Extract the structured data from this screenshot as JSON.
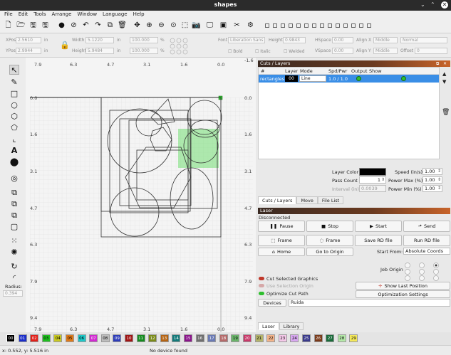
{
  "window": {
    "title": "shapes"
  },
  "menu": [
    "File",
    "Edit",
    "Tools",
    "Arrange",
    "Window",
    "Language",
    "Help"
  ],
  "toolbar_icons": [
    "new-file",
    "open-folder",
    "save",
    "save-as",
    "circle-fill",
    "stop-circle",
    "undo",
    "redo",
    "copy",
    "paste",
    "delete",
    "move",
    "zoom-in",
    "zoom-out",
    "zoom-fit",
    "zoom-page",
    "camera",
    "monitor",
    "frame",
    "tools",
    "settings"
  ],
  "props": {
    "xpos_label": "XPos",
    "xpos": "2.5610",
    "ypos_label": "YPos",
    "ypos": "2.9944",
    "width_label": "Width",
    "width": "5.1220",
    "height_label": "Height",
    "height": "5.9484",
    "unit": "in",
    "pct1": "100.000",
    "pct2": "100.000",
    "pct_unit": "%",
    "font_label": "Font",
    "font": "Liberation Sans",
    "fheight_label": "Height",
    "fheight": "0.9843",
    "hspace_label": "HSpace",
    "hspace": "0.00",
    "vspace_label": "VSpace",
    "vspace": "0.00",
    "alignx_label": "Align X",
    "alignx": "Middle",
    "aligny_label": "Align Y",
    "aligny": "Middle",
    "normal": "Normal",
    "offset_label": "Offset",
    "offset": "0",
    "bold": "Bold",
    "italic": "Italic",
    "welded": "Welded"
  },
  "tools": {
    "radius_label": "Radius:",
    "radius": "0.394"
  },
  "ruler": {
    "top": [
      "7.9",
      "6.3",
      "4.7",
      "3.1",
      "1.6",
      "0.0"
    ],
    "top_extra": "-1.6",
    "left": [
      "0.0",
      "1.6",
      "3.1",
      "4.7",
      "6.3",
      "7.9",
      "9.4"
    ],
    "right": [
      "0.0",
      "1.6",
      "3.1",
      "4.7",
      "6.3",
      "7.9",
      "9.4"
    ],
    "bottom": [
      "7.9",
      "6.3",
      "4.7",
      "3.1",
      "1.6",
      "0.0"
    ]
  },
  "cuts": {
    "title": "Cuts / Layers",
    "columns": [
      "#",
      "Layer",
      "Mode",
      "Spd/Pwr",
      "Output",
      "Show"
    ],
    "row": {
      "name": "rectangles",
      "layer": "00",
      "mode": "Line",
      "spdpwr": "1.0 / 1.0"
    },
    "layer_color_label": "Layer Color",
    "layer_color": "#000000",
    "speed_label": "Speed (in/s)",
    "speed": "1.00",
    "pass_label": "Pass Count",
    "pass": "1",
    "pmax_label": "Power Max (%)",
    "pmax": "1.00",
    "interval_label": "Interval (in)",
    "interval": "0.0039",
    "pmin_label": "Power Min (%)",
    "pmin": "1.00",
    "tabs": [
      "Cuts / Layers",
      "Move",
      "File List"
    ]
  },
  "laser": {
    "title": "Laser",
    "status": "Disconnected",
    "pause": "Pause",
    "stop": "Stop",
    "start": "Start",
    "send": "Send",
    "frame1": "Frame",
    "frame2": "Frame",
    "save_rd": "Save RD file",
    "run_rd": "Run RD file",
    "home": "Home",
    "goto_origin": "Go to Origin",
    "start_from_label": "Start From:",
    "start_from": "Absolute Coords",
    "job_origin": "Job Origin",
    "cut_selected": "Cut Selected Graphics",
    "use_selection": "Use Selection Origin",
    "optimize": "Optimize Cut Path",
    "show_last": "Show Last Position",
    "opt_settings": "Optimization Settings",
    "devices": "Devices",
    "device": "Ruida",
    "tabs": [
      "Laser",
      "Library"
    ]
  },
  "palette": [
    {
      "n": "00",
      "c": "#000000",
      "t": "#ffffff"
    },
    {
      "n": "01",
      "c": "#1b2ec8",
      "t": "#ffffff"
    },
    {
      "n": "02",
      "c": "#e0201a",
      "t": "#ffffff"
    },
    {
      "n": "03",
      "c": "#1fbf1f",
      "t": "#000000"
    },
    {
      "n": "04",
      "c": "#c8c824",
      "t": "#000000"
    },
    {
      "n": "05",
      "c": "#e07a18",
      "t": "#000000"
    },
    {
      "n": "06",
      "c": "#1ec8c8",
      "t": "#000000"
    },
    {
      "n": "07",
      "c": "#d02ad0",
      "t": "#ffffff"
    },
    {
      "n": "08",
      "c": "#bdbdbd",
      "t": "#000000"
    },
    {
      "n": "09",
      "c": "#2d3cb8",
      "t": "#ffffff"
    },
    {
      "n": "10",
      "c": "#a01414",
      "t": "#ffffff"
    },
    {
      "n": "11",
      "c": "#148a20",
      "t": "#ffffff"
    },
    {
      "n": "12",
      "c": "#7a8a1a",
      "t": "#ffffff"
    },
    {
      "n": "13",
      "c": "#b46414",
      "t": "#ffffff"
    },
    {
      "n": "14",
      "c": "#147a7a",
      "t": "#ffffff"
    },
    {
      "n": "15",
      "c": "#8a148a",
      "t": "#ffffff"
    },
    {
      "n": "16",
      "c": "#6e6e6e",
      "t": "#ffffff"
    },
    {
      "n": "17",
      "c": "#6a7ab4",
      "t": "#ffffff"
    },
    {
      "n": "18",
      "c": "#b46a6a",
      "t": "#ffffff"
    },
    {
      "n": "19",
      "c": "#6ab46a",
      "t": "#000000"
    },
    {
      "n": "20",
      "c": "#c83a6a",
      "t": "#ffffff"
    },
    {
      "n": "21",
      "c": "#b4b46a",
      "t": "#000000"
    },
    {
      "n": "22",
      "c": "#f4b48a",
      "t": "#000000"
    },
    {
      "n": "23",
      "c": "#f4c8e8",
      "t": "#000000"
    },
    {
      "n": "24",
      "c": "#d8a8f0",
      "t": "#000000"
    },
    {
      "n": "25",
      "c": "#3a3a8a",
      "t": "#ffffff"
    },
    {
      "n": "26",
      "c": "#7a3a1a",
      "t": "#ffffff"
    },
    {
      "n": "27",
      "c": "#1a6a3a",
      "t": "#ffffff"
    },
    {
      "n": "28",
      "c": "#b4e8a8",
      "t": "#000000"
    },
    {
      "n": "29",
      "c": "#f4e85a",
      "t": "#000000"
    }
  ],
  "status": {
    "coords": "x: 0.552, y: 5.516 in",
    "device": "No device found"
  }
}
